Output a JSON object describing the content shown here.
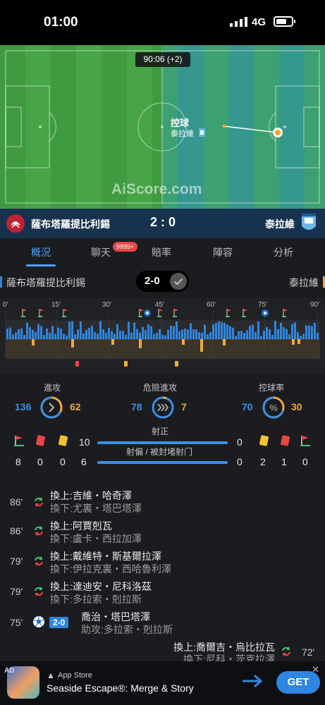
{
  "status_bar": {
    "time": "01:00",
    "network": "4G"
  },
  "live_pitch": {
    "clock": "90:06 (+2)",
    "possession_label": "控球",
    "possession_team": "泰拉維",
    "watermark": "AiScore.com"
  },
  "scoreboard": {
    "home_team": "薩布塔羅提比利錫",
    "away_team": "泰拉維",
    "score": "2 : 0"
  },
  "tabs": [
    {
      "label": "概況",
      "active": true
    },
    {
      "label": "聊天",
      "badge": "9999+"
    },
    {
      "label": "賠率"
    },
    {
      "label": "陣容"
    },
    {
      "label": "分析"
    }
  ],
  "summary": {
    "home_team": "薩布塔羅提比利錫",
    "away_team": "泰拉維",
    "result": "2-0"
  },
  "timeline": {
    "ticks": [
      "0'",
      "15'",
      "30'",
      "45'",
      "60'",
      "75'",
      "90'"
    ],
    "home_color": "#2f86e0",
    "away_color": "#f0a93a"
  },
  "stats": {
    "attack": {
      "label": "進攻",
      "home": "136",
      "away": "62"
    },
    "dangerous_attack": {
      "label": "危險進攻",
      "home": "78",
      "away": "7"
    },
    "possession": {
      "label": "控球率",
      "home": "70",
      "away": "30"
    },
    "shots_on": {
      "label": "射正",
      "home": "10",
      "away": "0"
    },
    "shots_off": {
      "label": "射偏 / 被封堵射门",
      "home": "6",
      "away": "0"
    },
    "home_corners": "8",
    "home_red": "0",
    "home_yellow": "0",
    "away_yellow": "2",
    "away_red": "1",
    "away_corners": "0"
  },
  "events": [
    {
      "minute": "86'",
      "in": "換上:吉維・哈奇澤",
      "out": "換下:尤裏・塔巴塔澤",
      "type": "sub",
      "side": "home"
    },
    {
      "minute": "86'",
      "in": "換上:阿賈剋瓦",
      "out": "換下:盧卡・西拉加澤",
      "type": "sub",
      "side": "home"
    },
    {
      "minute": "79'",
      "in": "換上:戴維特・斯基爾拉澤",
      "out": "換下:伊拉克裏・西哈魯利澤",
      "type": "sub",
      "side": "home"
    },
    {
      "minute": "79'",
      "in": "換上:達迪安・尼科洛茲",
      "out": "換下:多拉索・剋拉斯",
      "type": "sub",
      "side": "home"
    },
    {
      "minute": "75'",
      "score": "2-0",
      "scorer": "喬治・塔巴塔澤",
      "assist": "助攻:多拉索・剋拉斯",
      "type": "goal",
      "side": "home"
    },
    {
      "minute": "72'",
      "in": "換上:喬爾吉・烏比拉瓦",
      "out": "換下:尼科・茨克拉澤",
      "type": "sub",
      "side": "away"
    }
  ],
  "ad": {
    "tag": "AD",
    "store": "App Store",
    "title": "Seaside Escape®: Merge & Story",
    "cta": "GET"
  }
}
